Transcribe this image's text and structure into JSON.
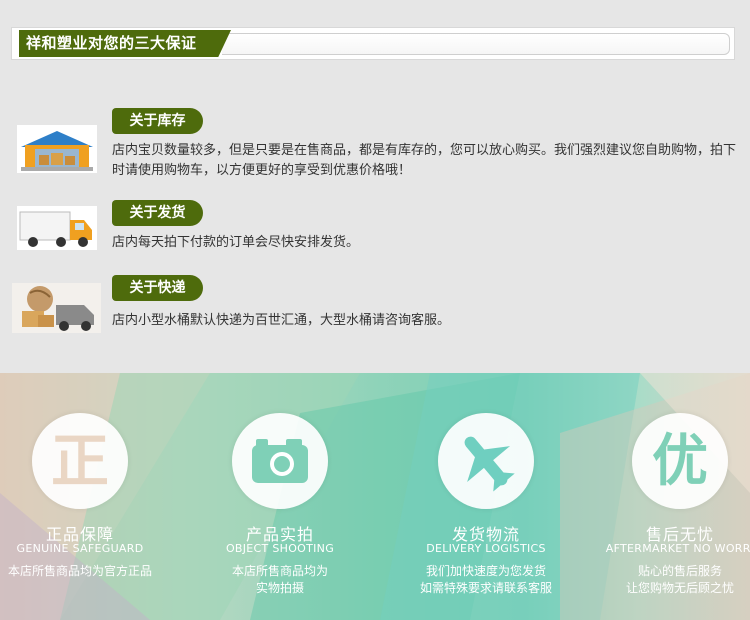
{
  "header": {
    "title": "祥和塑业对您的三大保证"
  },
  "guarantees": [
    {
      "label": "关于库存",
      "text": "店内宝贝数量较多，但是只要是在售商品，都是有库存的，您可以放心购买。我们强烈建议您自助购物，拍下时请使用购物车，以方便更好的享受到优惠价格哦！",
      "icon": "warehouse-icon"
    },
    {
      "label": "关于发货",
      "text": "店内每天拍下付款的订单会尽快安排发货。",
      "icon": "truck-icon"
    },
    {
      "label": "关于快递",
      "text": "店内小型水桶默认快递为百世汇通，大型水桶请咨询客服。",
      "icon": "delivery-van-icon"
    }
  ],
  "features": [
    {
      "title": "正品保障",
      "en": "GENUINE SAFEGUARD",
      "desc1": "本店所售商品均为官方正品",
      "desc2": "",
      "symbol": "正",
      "icon": "genuine-icon"
    },
    {
      "title": "产品实拍",
      "en": "OBJECT SHOOTING",
      "desc1": "本店所售商品均为",
      "desc2": "实物拍摄",
      "symbol": "",
      "icon": "camera-icon"
    },
    {
      "title": "发货物流",
      "en": "DELIVERY LOGISTICS",
      "desc1": "我们加快速度为您发货",
      "desc2": "如需特殊要求请联系客服",
      "symbol": "",
      "icon": "airplane-icon"
    },
    {
      "title": "售后无忧",
      "en": "AFTERMARKET NO WORRI",
      "desc1": "贴心的售后服务",
      "desc2": "让您购物无后顾之忧",
      "symbol": "优",
      "icon": "aftersale-icon"
    }
  ],
  "colors": {
    "accent": "#4e6b0c",
    "feature_icon": "#7fd0b7",
    "icon_blue": "#3b8fd3",
    "icon_orange": "#f0a020"
  }
}
